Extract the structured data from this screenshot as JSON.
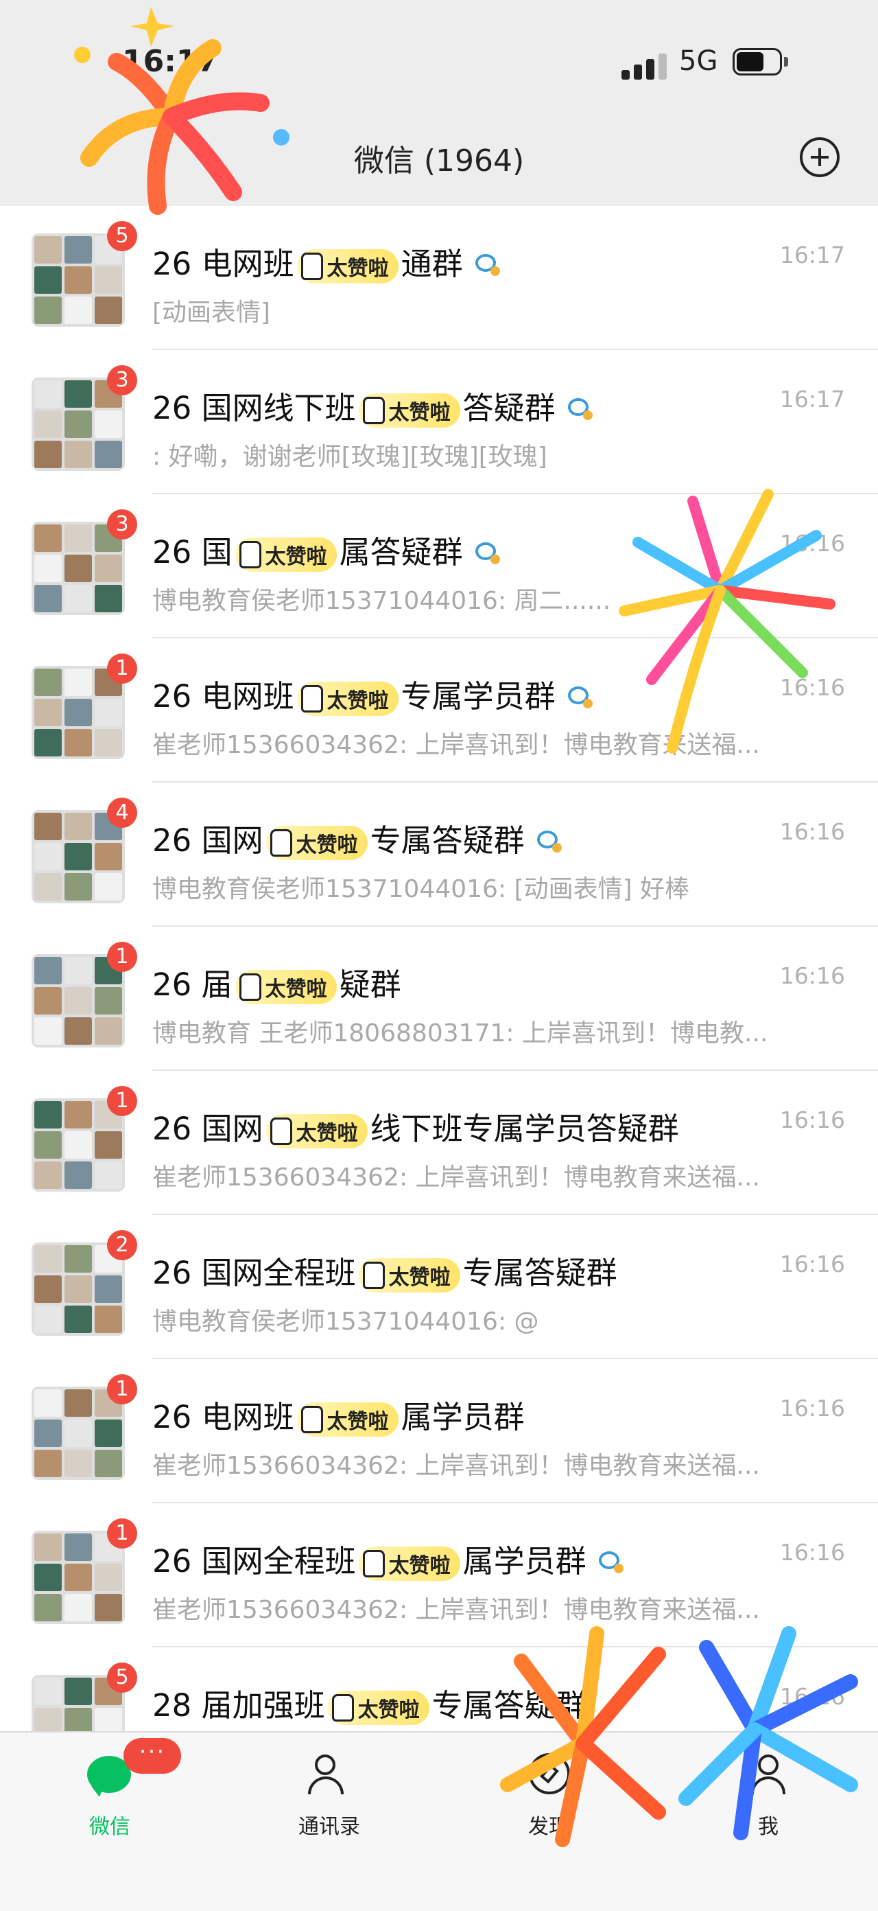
{
  "status_bar": {
    "time": "16:17",
    "network": "5G",
    "battery_level": 0.7,
    "signal_bars": 4
  },
  "header": {
    "title": "微信 (1964)"
  },
  "chats": [
    {
      "title_visible": "26 电网班",
      "title_end": "通群",
      "preview_before": "",
      "preview": "[动画表情]",
      "time": "16:17",
      "unread": "5",
      "has_group_icon": true
    },
    {
      "title_visible": "26 国网线下班",
      "title_end": "答疑群",
      "preview_before": "",
      "preview": ": 好嘞，谢谢老师[玫瑰][玫瑰][玫瑰]",
      "time": "16:17",
      "unread": "3",
      "has_group_icon": true
    },
    {
      "title_visible": "26 国",
      "title_end": "属答疑群",
      "preview_before": "",
      "preview": "博电教育侯老师15371044016: 周二......",
      "time": "16:16",
      "unread": "3",
      "has_group_icon": true
    },
    {
      "title_visible": "26 电网班",
      "title_end": "专属学员群",
      "preview_before": "",
      "preview": "崔老师15366034362: 上岸喜讯到！博电教育来送福...",
      "time": "16:16",
      "unread": "1",
      "has_group_icon": true
    },
    {
      "title_visible": "26 国网",
      "title_end": "专属答疑群",
      "preview_before": "",
      "preview": "博电教育侯老师15371044016: [动画表情] 好棒",
      "time": "16:16",
      "unread": "4",
      "has_group_icon": true
    },
    {
      "title_visible": "26 届",
      "title_end": "疑群",
      "preview_before": "",
      "preview": "博电教育 王老师18068803171: 上岸喜讯到！博电教...",
      "time": "16:16",
      "unread": "1",
      "has_group_icon": false
    },
    {
      "title_visible": "26 国网",
      "title_end": "线下班专属学员答疑群",
      "preview_before": "",
      "preview": "崔老师15366034362: 上岸喜讯到！博电教育来送福...",
      "time": "16:16",
      "unread": "1",
      "has_group_icon": false
    },
    {
      "title_visible": "26 国网全程班",
      "title_end": "专属答疑群",
      "preview_before": "",
      "preview": "博电教育侯老师15371044016: @",
      "time": "16:16",
      "unread": "2",
      "has_group_icon": false
    },
    {
      "title_visible": "26 电网班",
      "title_end": "属学员群",
      "preview_before": "",
      "preview": "崔老师15366034362: 上岸喜讯到！博电教育来送福...",
      "time": "16:16",
      "unread": "1",
      "has_group_icon": false
    },
    {
      "title_visible": "26 国网全程班",
      "title_end": "属学员群",
      "preview_before": "",
      "preview": "崔老师15366034362: 上岸喜讯到！博电教育来送福...",
      "time": "16:16",
      "unread": "1",
      "has_group_icon": true
    },
    {
      "title_visible": "28 届加强班",
      "title_end": "专属答疑群",
      "preview_before": "",
      "preview": "",
      "time": "16:16",
      "unread": "5",
      "has_group_icon": false
    }
  ],
  "sticker_text": "太赞啦",
  "tabs": [
    {
      "label": "微信",
      "icon": "chat-bubble-icon",
      "active": true,
      "badge": "···"
    },
    {
      "label": "通讯录",
      "icon": "contacts-icon",
      "active": false
    },
    {
      "label": "发现",
      "icon": "discover-compass-icon",
      "active": false
    },
    {
      "label": "我",
      "icon": "me-person-icon",
      "active": false
    }
  ],
  "colors": {
    "accent": "#07c160",
    "badge": "#f04a3e",
    "muted": "#a9a9a9",
    "background": "#ededed"
  }
}
